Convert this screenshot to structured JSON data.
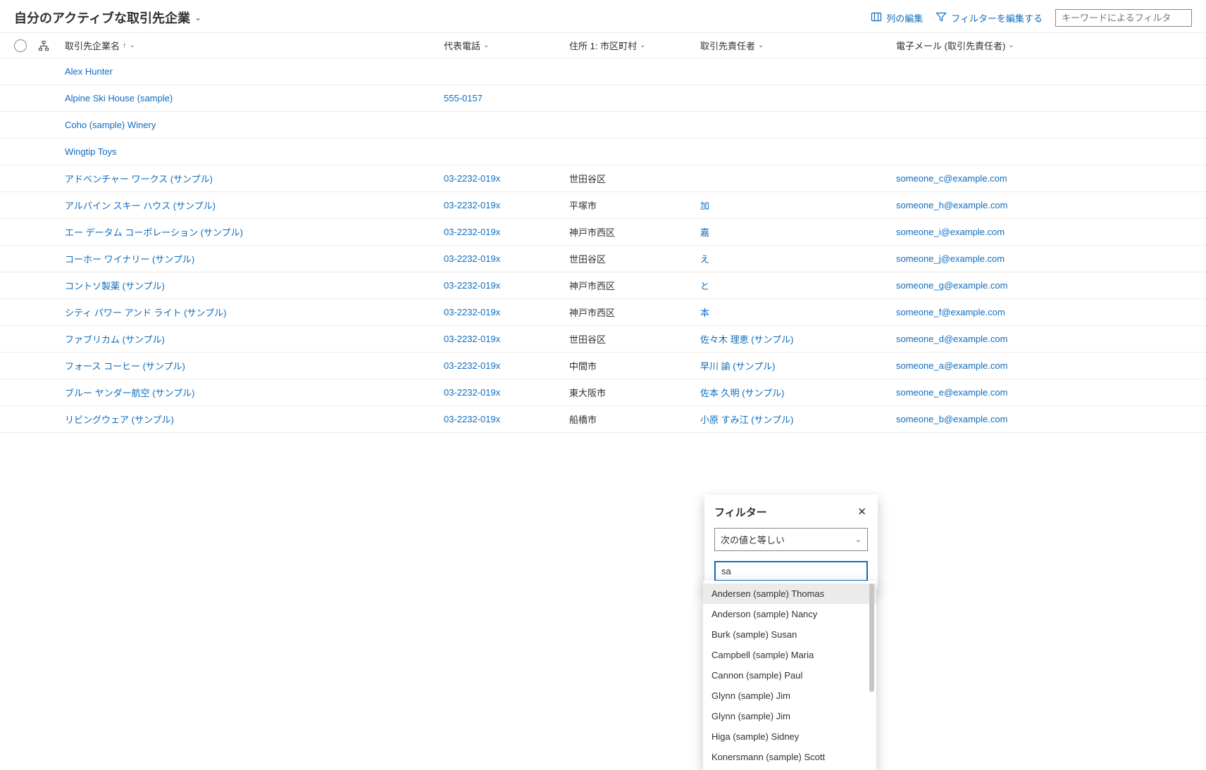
{
  "header": {
    "title": "自分のアクティブな取引先企業",
    "edit_columns": "列の編集",
    "edit_filters": "フィルターを編集する",
    "search_placeholder": "キーワードによるフィルタ"
  },
  "columns": {
    "name": "取引先企業名",
    "phone": "代表電話",
    "city": "住所 1: 市区町村",
    "contact": "取引先責任者",
    "email": "電子メール (取引先責任者)"
  },
  "rows": [
    {
      "name": "Alex Hunter",
      "phone": "",
      "city": "",
      "contact": "",
      "email": ""
    },
    {
      "name": "Alpine Ski House (sample)",
      "phone": "555-0157",
      "city": "",
      "contact": "",
      "email": ""
    },
    {
      "name": "Coho (sample) Winery",
      "phone": "",
      "city": "",
      "contact": "",
      "email": ""
    },
    {
      "name": "Wingtip Toys",
      "phone": "",
      "city": "",
      "contact": "",
      "email": ""
    },
    {
      "name": "アドベンチャー ワークス (サンプル)",
      "phone": "03-2232-019x",
      "city": "世田谷区",
      "contact": "",
      "email": "someone_c@example.com"
    },
    {
      "name": "アルパイン スキー ハウス (サンプル)",
      "phone": "03-2232-019x",
      "city": "平塚市",
      "contact": "加",
      "email": "someone_h@example.com"
    },
    {
      "name": "エー データム コーポレーション (サンプル)",
      "phone": "03-2232-019x",
      "city": "神戸市西区",
      "contact": "嘉",
      "email": "someone_i@example.com"
    },
    {
      "name": "コーホー ワイナリー (サンプル)",
      "phone": "03-2232-019x",
      "city": "世田谷区",
      "contact": "え",
      "email": "someone_j@example.com"
    },
    {
      "name": "コントソ製薬 (サンプル)",
      "phone": "03-2232-019x",
      "city": "神戸市西区",
      "contact": "と",
      "email": "someone_g@example.com"
    },
    {
      "name": "シティ パワー アンド ライト (サンプル)",
      "phone": "03-2232-019x",
      "city": "神戸市西区",
      "contact": "本",
      "email": "someone_f@example.com"
    },
    {
      "name": "ファブリカム (サンプル)",
      "phone": "03-2232-019x",
      "city": "世田谷区",
      "contact": "佐々木 理恵 (サンプル)",
      "email": "someone_d@example.com"
    },
    {
      "name": "フォース コーヒー (サンプル)",
      "phone": "03-2232-019x",
      "city": "中間市",
      "contact": "早川 諭 (サンプル)",
      "email": "someone_a@example.com"
    },
    {
      "name": "ブルー ヤンダー航空 (サンプル)",
      "phone": "03-2232-019x",
      "city": "東大阪市",
      "contact": "佐本 久明 (サンプル)",
      "email": "someone_e@example.com"
    },
    {
      "name": "リビングウェア (サンプル)",
      "phone": "03-2232-019x",
      "city": "船橋市",
      "contact": "小原 すみ江 (サンプル)",
      "email": "someone_b@example.com"
    }
  ],
  "filter": {
    "title": "フィルター",
    "operator": "次の値と等しい",
    "input_value": "sa",
    "suggestions": [
      "Andersen (sample) Thomas",
      "Anderson (sample) Nancy",
      "Burk (sample) Susan",
      "Campbell (sample) Maria",
      "Cannon (sample) Paul",
      "Glynn (sample) Jim",
      "Glynn (sample) Jim",
      "Higa (sample) Sidney",
      "Konersmann (sample) Scott"
    ]
  }
}
